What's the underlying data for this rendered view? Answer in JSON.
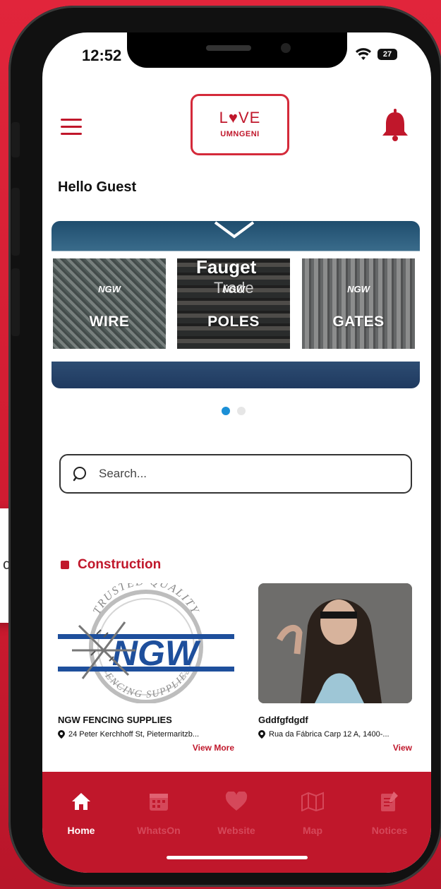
{
  "status_bar": {
    "time": "12:52",
    "battery": "27"
  },
  "header": {
    "logo_love": "L♥VE",
    "logo_sub": "UMNGENI"
  },
  "greeting": "Hello Guest",
  "banner": {
    "title": "Fauget",
    "subtitle": "Trade",
    "tiles": [
      {
        "brand": "NGW",
        "label": "WIRE"
      },
      {
        "brand": "NGW",
        "label": "POLES"
      },
      {
        "brand": "NGW",
        "label": "GATES"
      }
    ]
  },
  "search": {
    "placeholder": "Search..."
  },
  "float_card": {
    "text": "cts"
  },
  "section": {
    "title": "Construction"
  },
  "listings": [
    {
      "logo_arc_top": "TRUSTED QUALITY",
      "logo_main": "NGW",
      "logo_arc_bottom": "FENCING SUPPLIES",
      "name": "NGW FENCING SUPPLIES",
      "address": "24 Peter Kerchhoff St, Pietermaritzb...",
      "link": "View More"
    },
    {
      "name": "Gddfgfdgdf",
      "address": "Rua da Fábrica Carp 12 A, 1400-...",
      "link": "View"
    }
  ],
  "nav": [
    {
      "label": "Home",
      "icon": "home-icon"
    },
    {
      "label": "WhatsOn",
      "icon": "calendar-icon"
    },
    {
      "label": "Website",
      "icon": "heart-icon"
    },
    {
      "label": "Map",
      "icon": "map-icon"
    },
    {
      "label": "Notices",
      "icon": "notices-icon"
    }
  ],
  "colors": {
    "brand": "#c0172b",
    "background": "#d81f35",
    "dot_active": "#1b8fd6"
  }
}
